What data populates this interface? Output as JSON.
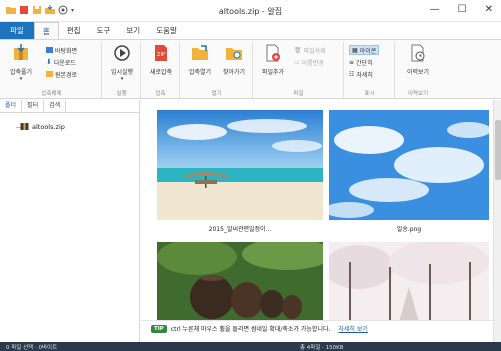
{
  "window": {
    "title": "altools.zip - 알집"
  },
  "tabs": [
    "파일",
    "홈",
    "편집",
    "도구",
    "보기",
    "도움말"
  ],
  "ribbon": {
    "groups": [
      {
        "label": "압축해제"
      },
      {
        "label": "실행"
      },
      {
        "label": "압축"
      },
      {
        "label": "열기"
      },
      {
        "label": "파일"
      },
      {
        "label": "표시"
      },
      {
        "label": "이력보기"
      }
    ],
    "extract_button": "압축풀기",
    "extract_small": [
      "바탕화면",
      "다운로드",
      "원본경로"
    ],
    "run_button": "임시실행",
    "new_archive_button": "새로압축",
    "open_archive_button": "압축열기",
    "find_button": "찾아가기",
    "add_file_button": "파일추가",
    "file_small": [
      "파일삭제",
      "이름변경"
    ],
    "view_small": [
      "아이콘",
      "간단히",
      "자세히"
    ],
    "history_button": "이력보기"
  },
  "left_panel": {
    "tabs": [
      "폴더",
      "필터",
      "검색"
    ],
    "tree_item": "altools.zip"
  },
  "files": [
    {
      "name": "2015_알씨관련일정이...",
      "kind": "beach"
    },
    {
      "name": "알송.png",
      "kind": "sky"
    },
    {
      "name": "",
      "kind": "jars"
    },
    {
      "name": "",
      "kind": "blossom"
    }
  ],
  "tip": {
    "badge": "TIP",
    "text": "ctrl 누른채 마우스 휠을 돌리면 썸네일 확대/축소가 가능합니다.",
    "link": "자세히 보기"
  },
  "status": {
    "left": "0 파일 선택 · 0바이트",
    "right": "총 4파일 · 150KB"
  },
  "colors": {
    "accent": "#1e73be",
    "status_bg": "#2b3a4a",
    "tip_green": "#2e8b3a"
  }
}
